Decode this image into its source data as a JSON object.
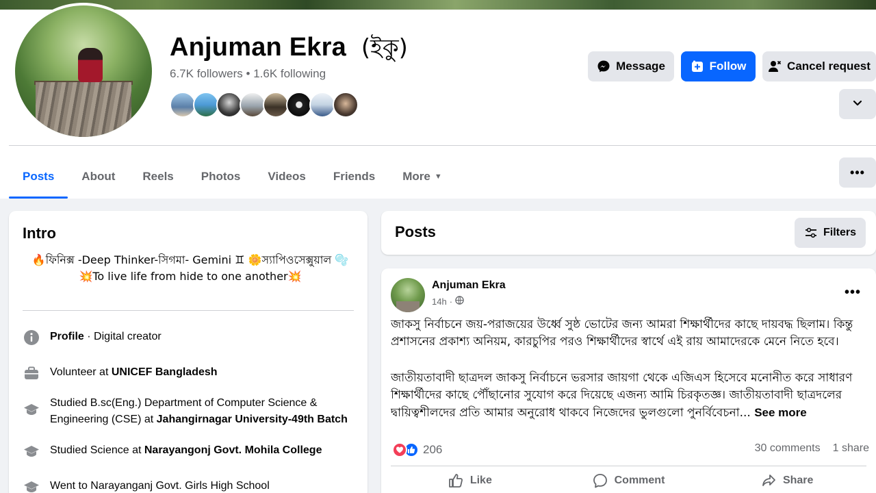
{
  "profile": {
    "name": "Anjuman Ekra",
    "nickname": "(ইকু)",
    "followers": "6.7K followers",
    "separator": " • ",
    "following": "1.6K following"
  },
  "header_buttons": {
    "message": "Message",
    "follow": "Follow",
    "cancel_request": "Cancel request"
  },
  "tabs": [
    "Posts",
    "About",
    "Reels",
    "Photos",
    "Videos",
    "Friends",
    "More"
  ],
  "intro": {
    "title": "Intro",
    "bio_line1": "🔥ফিনিক্স -Deep Thinker-সিগমা- Gemini ♊ 🌼স্যাপিওসেক্সুয়াল 🫧",
    "bio_line2": "💥To live life from hide to one another💥",
    "items": [
      {
        "prefix": "",
        "bold": "Profile",
        "suffix": " · Digital creator"
      },
      {
        "prefix": "Volunteer at ",
        "bold": "UNICEF Bangladesh",
        "suffix": ""
      },
      {
        "prefix": "Studied B.sc(Eng.) Department of Computer Science & Engineering (CSE) at ",
        "bold": "Jahangirnagar University-49th Batch",
        "suffix": ""
      },
      {
        "prefix": "Studied Science at ",
        "bold": "Narayangonj Govt. Mohila College",
        "suffix": ""
      },
      {
        "prefix": "Went to Narayanganj Govt. Girls High School",
        "bold": "",
        "suffix": ""
      }
    ]
  },
  "posts_section": {
    "title": "Posts",
    "filters": "Filters"
  },
  "post": {
    "author": "Anjuman Ekra",
    "time": "14h",
    "para1": "জাকসু নির্বাচনে জয়-পরাজয়ের উর্ধ্বে সুষ্ঠ ভোটের জন্য আমরা শিক্ষার্থীদের কাছে দায়বদ্ধ ছিলাম। কিন্তু প্রশাসনের প্রকাশ্য অনিয়ম, কারচুপির পরও শিক্ষার্থীদের স্বার্থে এই রায় আমাদেরকে মেনে নিতে হবে।",
    "para2": "জাতীয়তাবাদী ছাত্রদল জাকসু নির্বাচনে ভরসার জায়গা থেকে এজিএস হিসেবে মনোনীত করে সাধারণ শিক্ষার্থীদের কাছে পৌঁছানোর সুযোগ করে দিয়েছে এজন্য আমি চিরকৃতজ্ঞ। জাতীয়তাবাদী ছাত্রদলের দ্বায়িত্বশীলদের প্রতি আমার অনুরোধ থাকবে নিজেদের ভুলগুলো পুনর্বিবেচনা...",
    "see_more": "See more",
    "reaction_count": "206",
    "comments": "30 comments",
    "shares": "1 share",
    "like": "Like",
    "comment": "Comment",
    "share": "Share"
  },
  "colors": {
    "accent": "#0866ff",
    "secondary_text": "#65676b",
    "button_gray": "#e4e6eb",
    "page_bg": "#f0f2f5",
    "love_red": "#f33e58"
  },
  "icons": [
    "messenger-icon",
    "add-friend-icon",
    "person-cancel-icon",
    "chevron-down-icon",
    "ellipsis-icon",
    "filter-icon",
    "info-icon",
    "briefcase-icon",
    "graduation-cap-icon",
    "globe-icon",
    "like-icon",
    "comment-icon",
    "share-icon"
  ]
}
